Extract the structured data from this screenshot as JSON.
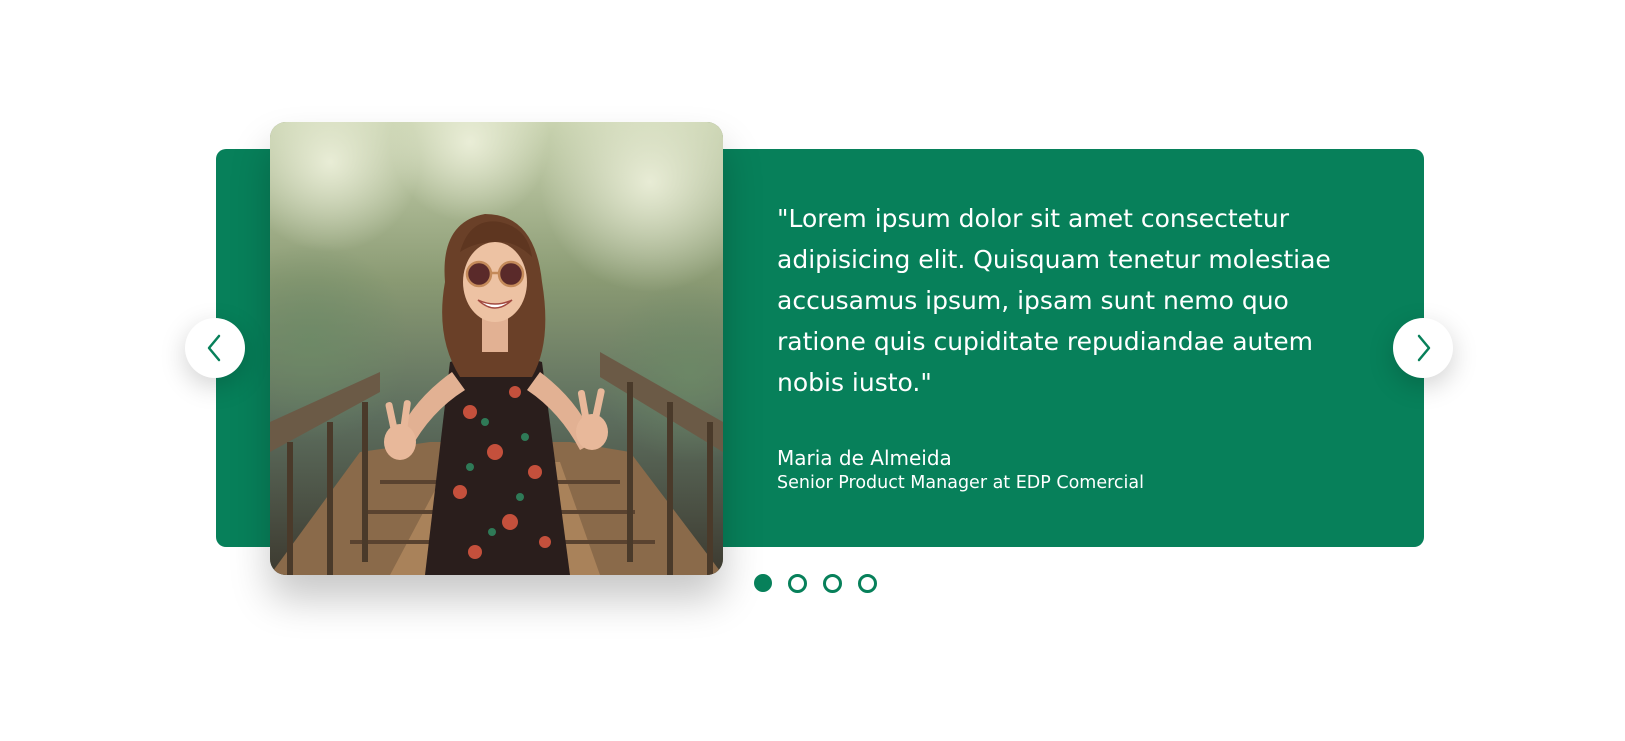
{
  "testimonial": {
    "quote": "\"Lorem ipsum dolor sit amet consectetur adipisicing elit. Quisquam tenetur molestiae accusamus ipsum, ipsam sunt nemo quo ratione quis cupiditate repudiandae autem nobis iusto.\"",
    "author_name": "Maria de Almeida",
    "author_role": "Senior Product Manager at EDP Comercial"
  },
  "icons": {
    "prev": "chevron-left-icon",
    "next": "chevron-right-icon"
  },
  "colors": {
    "accent": "#07805a",
    "background": "#ffffff",
    "text_on_accent": "#ffffff"
  },
  "pagination": {
    "total": 4,
    "active_index": 0
  }
}
